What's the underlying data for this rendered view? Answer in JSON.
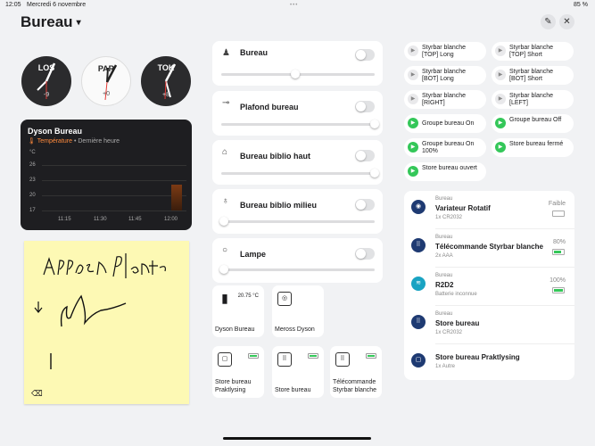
{
  "status": {
    "time": "12:05",
    "date": "Mercredi 6 novembre",
    "battery": "85 %"
  },
  "header": {
    "title": "Bureau",
    "caret": "▾",
    "edit_icon": "✎",
    "close_icon": "✕"
  },
  "clocks": [
    {
      "label": "LOS",
      "offset": "-9",
      "theme": "dark"
    },
    {
      "label": "PAR",
      "offset": "+0",
      "theme": "light"
    },
    {
      "label": "TOK",
      "offset": "+8",
      "theme": "dark"
    }
  ],
  "chart_data": {
    "type": "bar",
    "title": "Dyson Bureau",
    "metric": "Température",
    "subtitle": "• Dernière heure",
    "ylabel": "°C",
    "yticks": [
      "26",
      "23",
      "20",
      "17",
      "14"
    ],
    "xticks": [
      "11:15",
      "11:30",
      "11:45",
      "12:00"
    ],
    "x": [
      "12:00"
    ],
    "values": [
      20.75
    ],
    "ylim": [
      14,
      26
    ]
  },
  "note": {
    "eraser_icon": "⌫"
  },
  "lights": [
    {
      "name": "Bureau",
      "icon": "♟",
      "level": 0.48
    },
    {
      "name": "Plafond bureau",
      "icon": "⊸",
      "level": 1.0
    },
    {
      "name": "Bureau biblio haut",
      "icon": "⌂",
      "level": 1.0
    },
    {
      "name": "Bureau biblio milieu",
      "icon": "♁",
      "level": 0.0
    },
    {
      "name": "Lampe",
      "icon": "○",
      "level": 0.0
    }
  ],
  "tiles": [
    {
      "label": "Dyson Bureau",
      "value": "20.75 °C",
      "icon": "▮"
    },
    {
      "label": "Meross Dyson",
      "value": "",
      "icon": "◎"
    },
    {
      "label": "Store bureau Praktlysing",
      "value": "",
      "icon": "▢"
    },
    {
      "label": "Store bureau",
      "value": "",
      "icon": "⠿"
    },
    {
      "label": "Télécommande Styrbar blanche",
      "value": "",
      "icon": "⠿"
    }
  ],
  "scenes": [
    {
      "text": "Styrbar blanche [TOP] Long",
      "icon": "▶",
      "active": false
    },
    {
      "text": "Styrbar blanche [TOP] Short",
      "icon": "▶",
      "active": false
    },
    {
      "text": "Styrbar blanche [BOT] Long",
      "icon": "▶",
      "active": false
    },
    {
      "text": "Styrbar blanche [BOT] Short",
      "icon": "▶",
      "active": false
    },
    {
      "text": "Styrbar blanche [RIGHT]",
      "icon": "▶",
      "active": false
    },
    {
      "text": "Styrbar blanche [LEFT]",
      "icon": "▶",
      "active": false
    },
    {
      "text": "Groupe bureau On",
      "icon": "▶",
      "active": true
    },
    {
      "text": "Groupe bureau Off",
      "icon": "▶",
      "active": true
    },
    {
      "text": "Groupe bureau On 100%",
      "icon": "▶",
      "active": true
    },
    {
      "text": "Store bureau fermé",
      "icon": "▶",
      "active": true
    },
    {
      "text": "Store bureau ouvert",
      "icon": "▶",
      "active": true
    }
  ],
  "devices": [
    {
      "parent": "Bureau",
      "name": "Variateur Rotatif",
      "sub": "1x CR2032",
      "value": "Faible",
      "level": 0.0,
      "icon": "◉"
    },
    {
      "parent": "Bureau",
      "name": "Télécommande Styrbar blanche",
      "sub": "2x AAA",
      "value": "80%",
      "level": 0.8,
      "icon": "⠿"
    },
    {
      "parent": "Bureau",
      "name": "R2D2",
      "sub": "Batterie inconnue",
      "value": "100%",
      "level": 1.0,
      "icon": "≋"
    },
    {
      "parent": "Bureau",
      "name": "Store bureau",
      "sub": "1x CR2032",
      "value": "",
      "level": null,
      "icon": "⠿"
    },
    {
      "parent": "",
      "name": "Store bureau Praktlysing",
      "sub": "1x Autre",
      "value": "",
      "level": null,
      "icon": "▢"
    }
  ]
}
